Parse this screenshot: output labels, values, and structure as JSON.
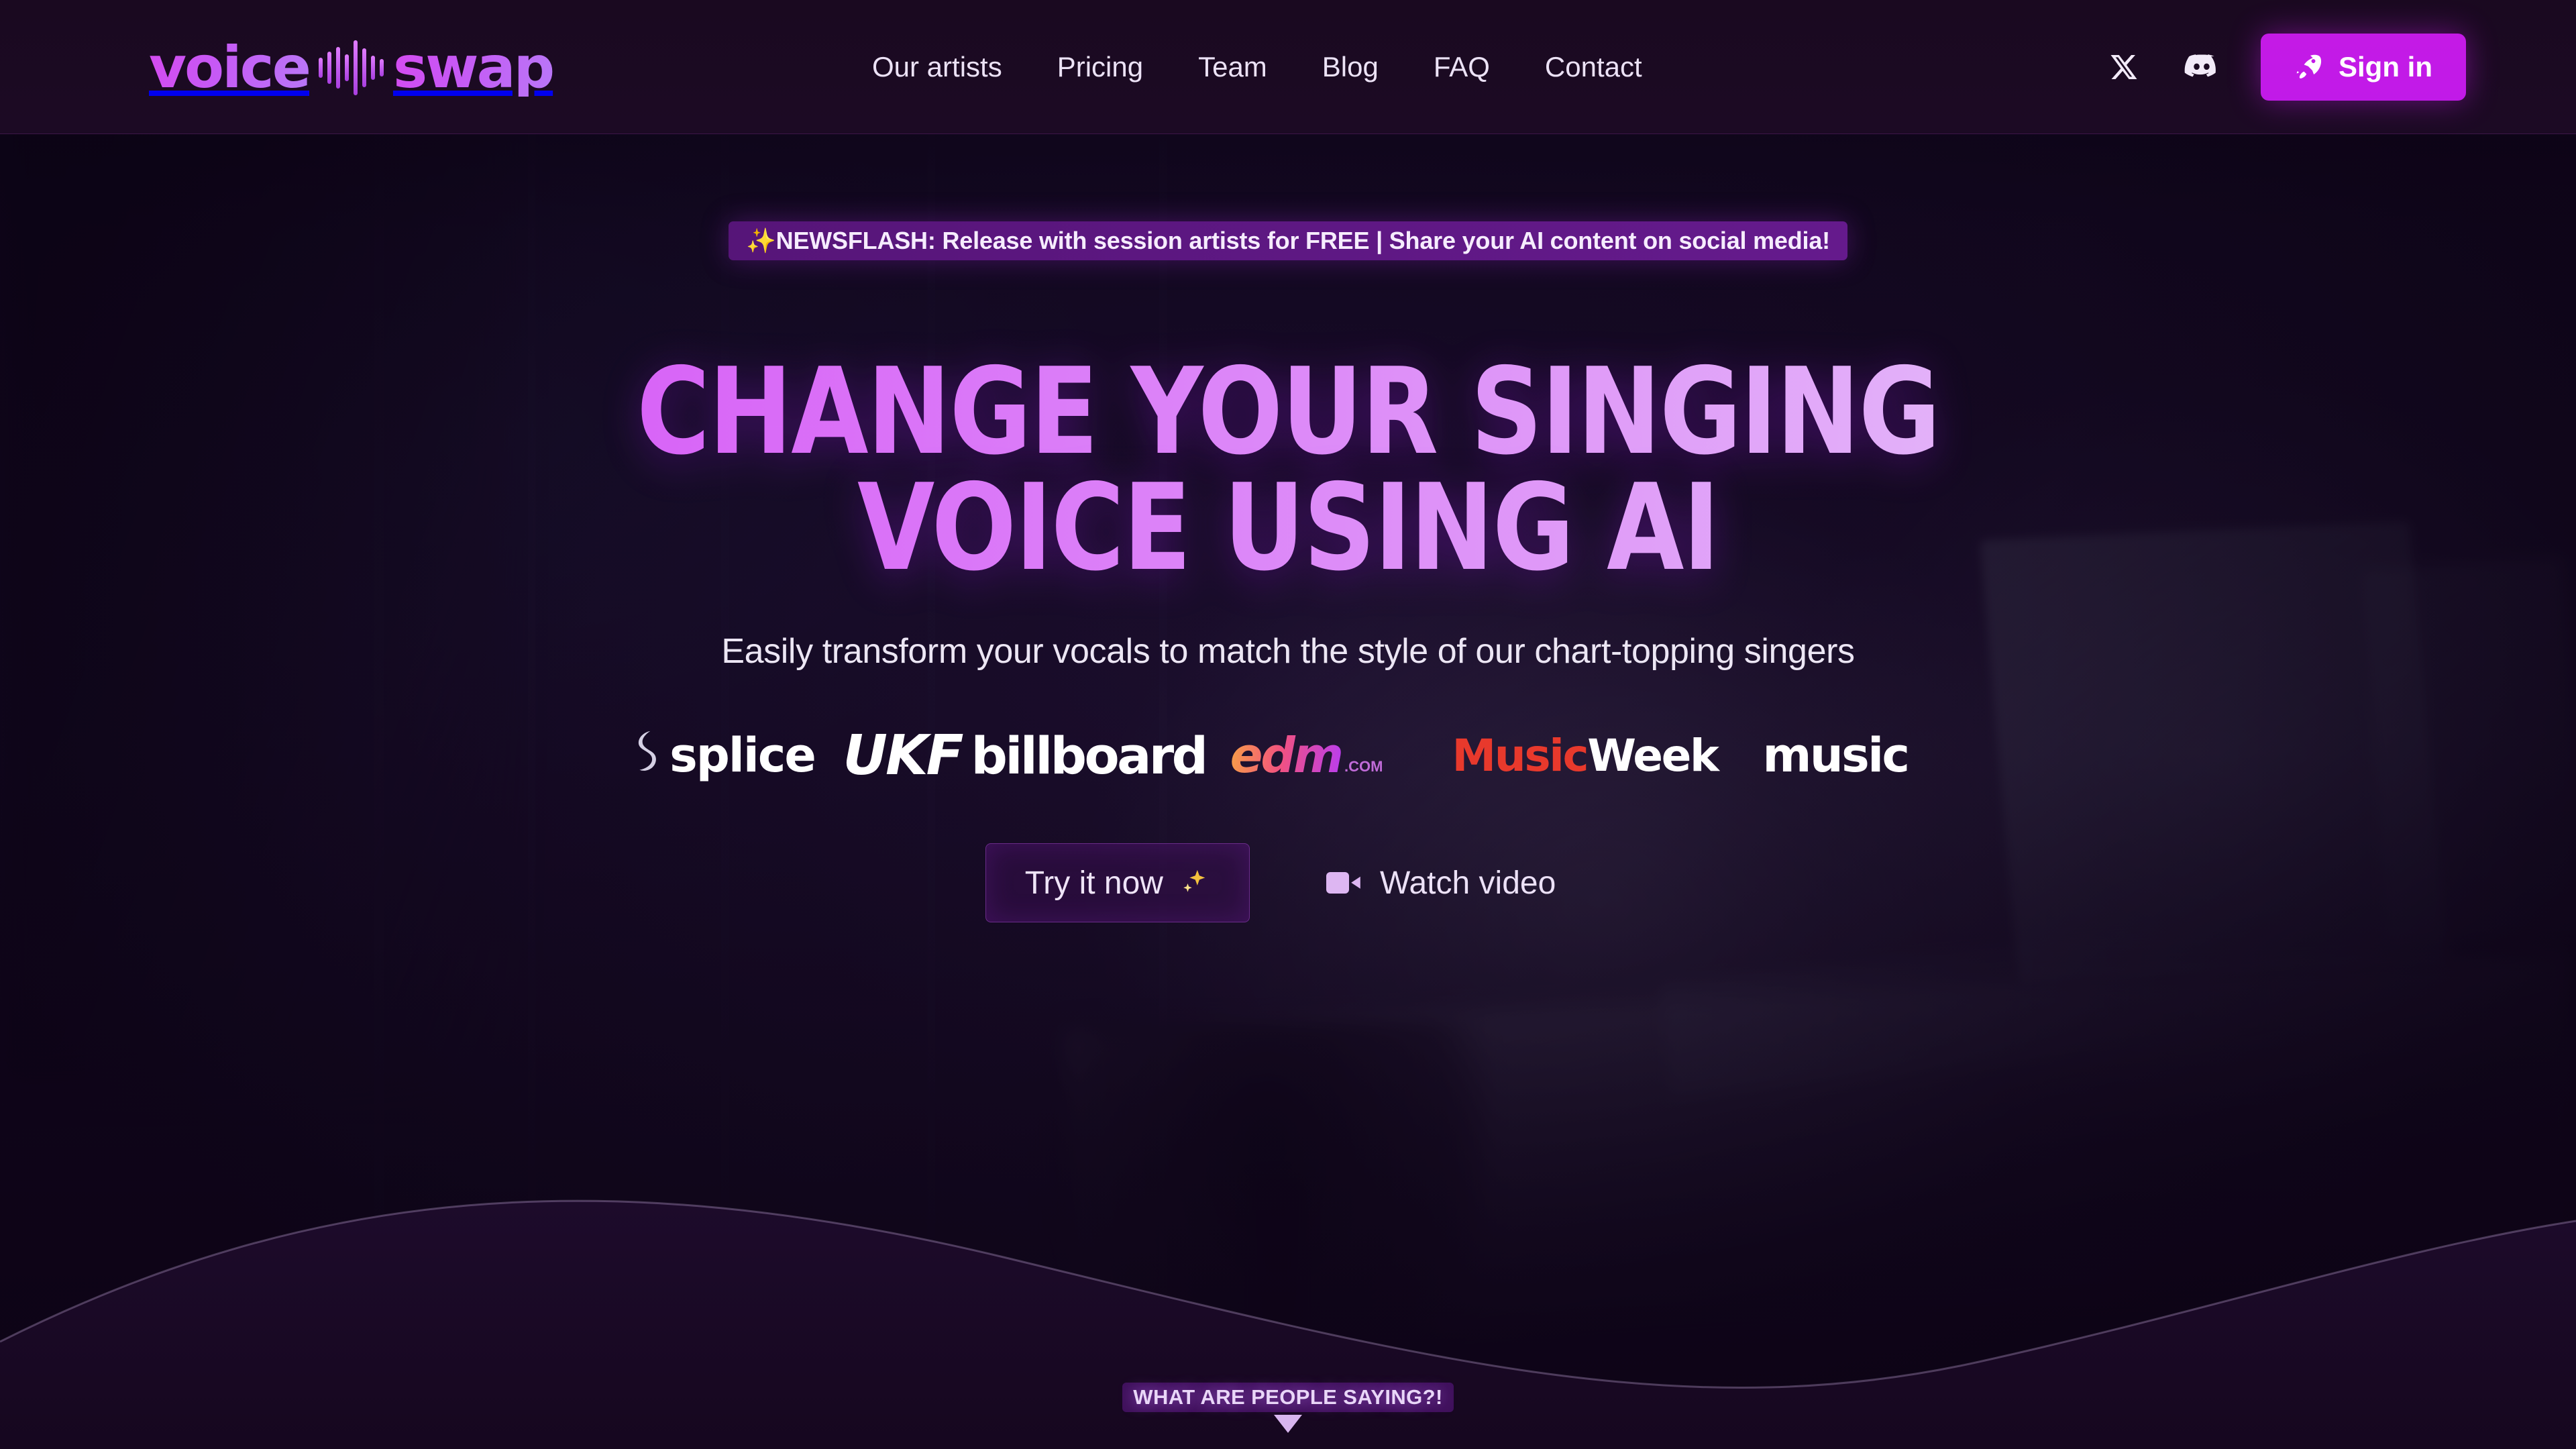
{
  "header": {
    "logo": {
      "word1": "voice",
      "word2": "swap",
      "wave_icon": "audio-waveform-icon"
    },
    "nav": [
      {
        "label": "Our artists"
      },
      {
        "label": "Pricing"
      },
      {
        "label": "Team"
      },
      {
        "label": "Blog"
      },
      {
        "label": "FAQ"
      },
      {
        "label": "Contact"
      }
    ],
    "social": [
      {
        "name": "x-twitter-icon"
      },
      {
        "name": "discord-icon"
      }
    ],
    "signin": {
      "label": "Sign in",
      "icon": "rocket-icon"
    }
  },
  "hero": {
    "newsflash": "✨NEWSFLASH: Release with session artists for FREE | Share your AI content on social media!",
    "headline_line1": "Change your singing",
    "headline_line2": "voice using AI",
    "subtitle": "Easily transform your vocals to match the style of our chart-topping singers",
    "press_logos": [
      {
        "name": "splice",
        "text": "splice"
      },
      {
        "name": "ukf",
        "text": "UKF"
      },
      {
        "name": "billboard",
        "text": "billboard"
      },
      {
        "name": "edm-com",
        "text": "edm",
        "suffix": ".COM"
      },
      {
        "name": "music-week",
        "text_a": "Music",
        "text_b": "Week"
      },
      {
        "name": "music-business",
        "text": "music"
      }
    ],
    "cta_primary": {
      "label": "Try it now",
      "icon": "sparkles-icon"
    },
    "cta_secondary": {
      "label": "Watch video",
      "icon": "video-camera-icon"
    }
  },
  "scroll_cue": {
    "label": "WHAT ARE PEOPLE SAYING?!",
    "icon": "chevron-down-icon"
  },
  "colors": {
    "brand_magenta": "#c41ae6",
    "brand_purple": "#9a3ad4",
    "headline_gradient_start": "#d44bf5",
    "headline_gradient_end": "#eccdfb",
    "header_bg": "#1a0920",
    "page_bg": "#130a1d",
    "banner_bg": "#5c1680",
    "musicweek_red": "#e8392c"
  }
}
